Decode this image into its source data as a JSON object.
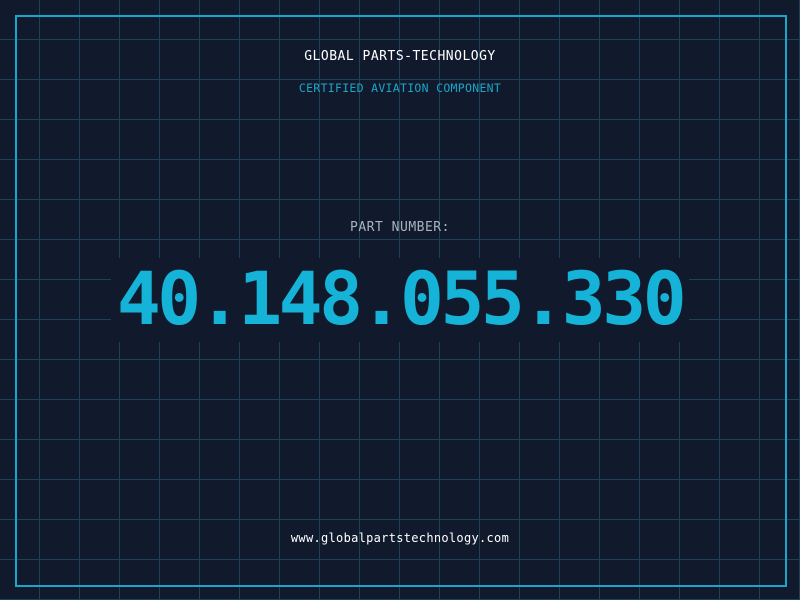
{
  "header": {
    "brand": "GLOBAL PARTS-TECHNOLOGY",
    "tagline": "CERTIFIED AVIATION COMPONENT"
  },
  "part": {
    "label": "PART NUMBER:",
    "number": "40.148.055.330"
  },
  "footer": {
    "website": "www.globalpartstechnology.com"
  },
  "colors": {
    "background": "#111a2d",
    "grid": "#1c4257",
    "accent": "#1ba5c8",
    "number": "#16b3d8",
    "label": "#a8b3bf",
    "text": "#ffffff"
  }
}
